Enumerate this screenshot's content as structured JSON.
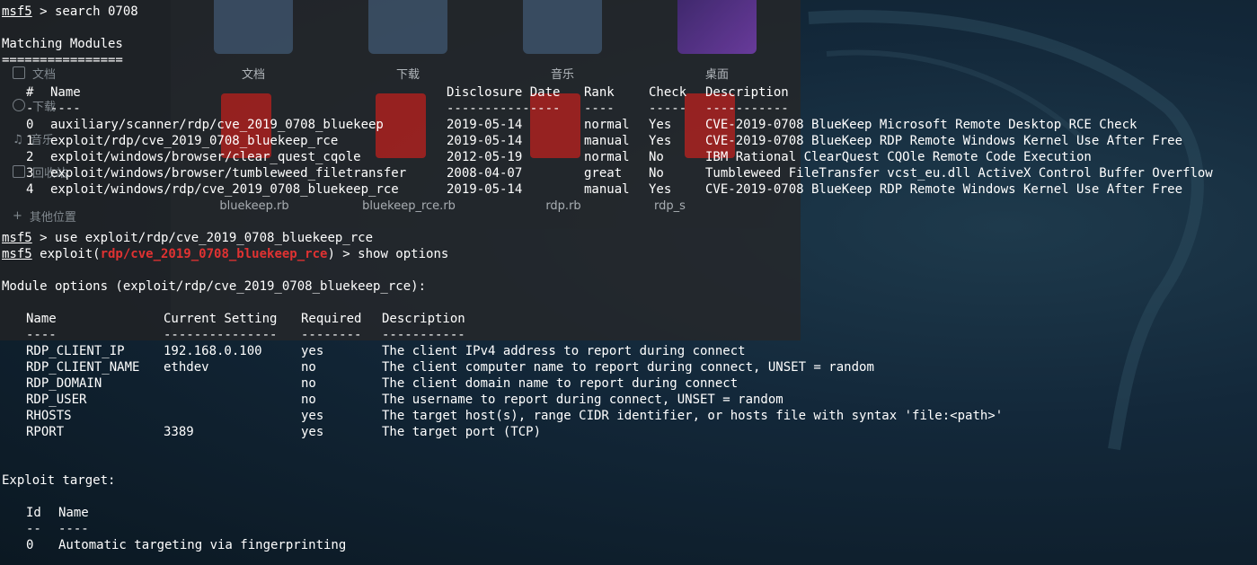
{
  "file_manager": {
    "sidebar": [
      {
        "label": "文档",
        "icon": "document-icon"
      },
      {
        "label": "下载",
        "icon": "download-icon"
      },
      {
        "label": "音乐",
        "icon": "music-icon"
      },
      {
        "label": "回收站",
        "icon": "trash-icon"
      },
      {
        "label": "其他位置",
        "icon": "plus-icon"
      }
    ],
    "folders": [
      {
        "label": "文档",
        "icon": "document-folder-icon"
      },
      {
        "label": "下载",
        "icon": "download-folder-icon"
      },
      {
        "label": "音乐",
        "icon": "music-folder-icon"
      },
      {
        "label": "桌面",
        "icon": "desktop-folder-icon"
      }
    ],
    "files": [
      {
        "label": "bluekeep.rb"
      },
      {
        "label": "bluekeep_rce.rb"
      },
      {
        "label": "rdp.rb"
      },
      {
        "label": "rdp_s"
      }
    ]
  },
  "terminal": {
    "prompt": "msf5",
    "cmd1": " > search 0708",
    "matching_title": "Matching Modules",
    "matching_underline": "================",
    "modules_header": {
      "num": "#",
      "name": "Name",
      "date": "Disclosure Date",
      "rank": "Rank",
      "check": "Check",
      "desc": "Description"
    },
    "modules_sep": {
      "num": "-",
      "name": "----",
      "date": "---------------",
      "rank": "----",
      "check": "-----",
      "desc": "-----------"
    },
    "modules": [
      {
        "num": "0",
        "name": "auxiliary/scanner/rdp/cve_2019_0708_bluekeep",
        "date": "2019-05-14",
        "rank": "normal",
        "check": "Yes",
        "desc": "CVE-2019-0708 BlueKeep Microsoft Remote Desktop RCE Check"
      },
      {
        "num": "1",
        "name": "exploit/rdp/cve_2019_0708_bluekeep_rce",
        "date": "2019-05-14",
        "rank": "manual",
        "check": "Yes",
        "desc": "CVE-2019-0708 BlueKeep RDP Remote Windows Kernel Use After Free"
      },
      {
        "num": "2",
        "name": "exploit/windows/browser/clear_quest_cqole",
        "date": "2012-05-19",
        "rank": "normal",
        "check": "No",
        "desc": "IBM Rational ClearQuest CQOle Remote Code Execution"
      },
      {
        "num": "3",
        "name": "exploit/windows/browser/tumbleweed_filetransfer",
        "date": "2008-04-07",
        "rank": "great",
        "check": "No",
        "desc": "Tumbleweed FileTransfer vcst_eu.dll ActiveX Control Buffer Overflow"
      },
      {
        "num": "4",
        "name": "exploit/windows/rdp/cve_2019_0708_bluekeep_rce",
        "date": "2019-05-14",
        "rank": "manual",
        "check": "Yes",
        "desc": "CVE-2019-0708 BlueKeep RDP Remote Windows Kernel Use After Free"
      }
    ],
    "cmd2": " > use exploit/rdp/cve_2019_0708_bluekeep_rce",
    "cmd3_pre": " exploit(",
    "cmd3_module": "rdp/cve_2019_0708_bluekeep_rce",
    "cmd3_post": ") > show options",
    "module_options_title": "Module options (exploit/rdp/cve_2019_0708_bluekeep_rce):",
    "options_header": {
      "name": "Name",
      "setting": "Current Setting",
      "required": "Required",
      "desc": "Description"
    },
    "options_sep": {
      "name": "----",
      "setting": "---------------",
      "required": "--------",
      "desc": "-----------"
    },
    "options": [
      {
        "name": "RDP_CLIENT_IP",
        "setting": "192.168.0.100",
        "required": "yes",
        "desc": "The client IPv4 address to report during connect"
      },
      {
        "name": "RDP_CLIENT_NAME",
        "setting": "ethdev",
        "required": "no",
        "desc": "The client computer name to report during connect, UNSET = random"
      },
      {
        "name": "RDP_DOMAIN",
        "setting": "",
        "required": "no",
        "desc": "The client domain name to report during connect"
      },
      {
        "name": "RDP_USER",
        "setting": "",
        "required": "no",
        "desc": "The username to report during connect, UNSET = random"
      },
      {
        "name": "RHOSTS",
        "setting": "",
        "required": "yes",
        "desc": "The target host(s), range CIDR identifier, or hosts file with syntax 'file:<path>'"
      },
      {
        "name": "RPORT",
        "setting": "3389",
        "required": "yes",
        "desc": "The target port (TCP)"
      }
    ],
    "exploit_target_title": "Exploit target:",
    "target_header": {
      "id": "Id",
      "name": "Name"
    },
    "target_sep": {
      "id": "--",
      "name": "----"
    },
    "targets": [
      {
        "id": "0",
        "name": "Automatic targeting via fingerprinting"
      }
    ]
  },
  "colors": {
    "terminal_text": "#ffffff",
    "module_highlight": "#e03232",
    "desktop_background": "#0d1b26"
  }
}
